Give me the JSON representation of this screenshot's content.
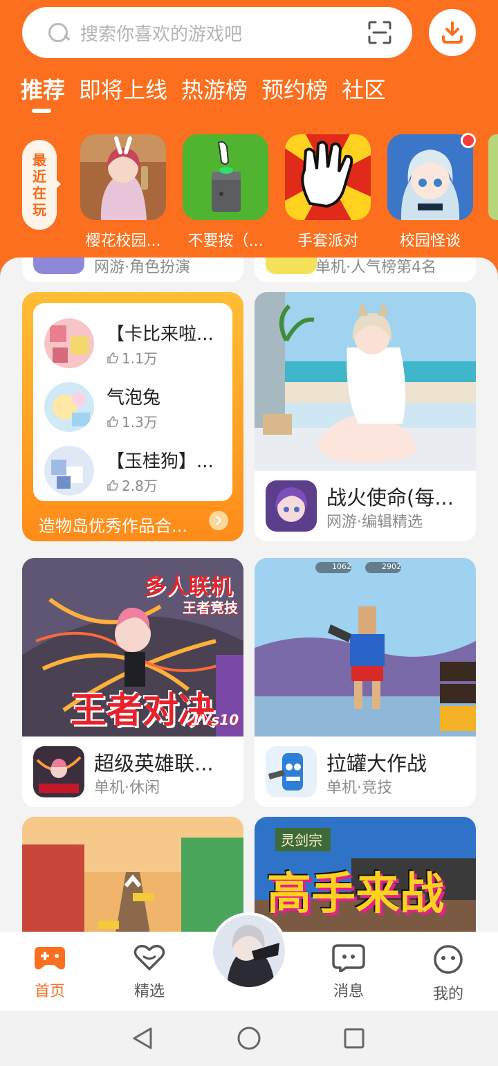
{
  "search": {
    "placeholder": "搜索你喜欢的游戏吧"
  },
  "tabs": [
    {
      "label": "推荐",
      "active": true
    },
    {
      "label": "即将上线"
    },
    {
      "label": "热游榜"
    },
    {
      "label": "预约榜"
    },
    {
      "label": "社区"
    }
  ],
  "recent": {
    "label": [
      "最",
      "近",
      "在",
      "玩"
    ]
  },
  "recent_games": [
    {
      "name": "樱花校园..."
    },
    {
      "name": "不要按（..."
    },
    {
      "name": "手套派对"
    },
    {
      "name": "校园怪谈"
    }
  ],
  "partial_cards": [
    {
      "sub": "网游·角色扮演"
    },
    {
      "sub": "单机·人气榜第4名"
    }
  ],
  "collection": {
    "items": [
      {
        "title": "【卡比来啦...",
        "likes": "1.1万"
      },
      {
        "title": "气泡兔",
        "likes": "1.3万"
      },
      {
        "title": "【玉桂狗】...",
        "likes": "2.8万"
      }
    ],
    "footer": "造物岛优秀作品合..."
  },
  "cards": [
    {
      "name": "战火使命(每...",
      "sub": "网游·编辑精选"
    },
    {
      "name": "超级英雄联...",
      "sub": "单机·休闲",
      "banner_title": "多人联机",
      "banner_sub": "王者竞技",
      "banner_big": "王者对决",
      "banner_tag": "1Vs10"
    },
    {
      "name": "拉罐大作战",
      "sub": "单机·竞技",
      "hud_a": "1062",
      "hud_b": "2902"
    },
    {
      "name": "",
      "sub": "",
      "banner_sign": "灵剑宗",
      "banner_big": "高手来战"
    }
  ],
  "nav": [
    {
      "label": "首页",
      "active": true
    },
    {
      "label": "精选"
    },
    {
      "label": "消息"
    },
    {
      "label": "我的"
    }
  ],
  "colors": {
    "brand": "#fb6f1e",
    "background": "#f3f3f3"
  }
}
